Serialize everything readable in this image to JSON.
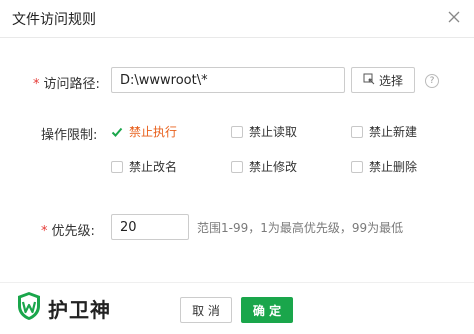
{
  "dialog": {
    "title": "文件访问规则"
  },
  "form": {
    "path_required_mark": "*",
    "path_label": "访问路径:",
    "path_value": "D:\\wwwroot\\*",
    "choose_button_label": "选择",
    "help_glyph": "?",
    "restriction_label": "操作限制:",
    "restrictions": [
      {
        "label": "禁止执行",
        "checked": true
      },
      {
        "label": "禁止读取",
        "checked": false
      },
      {
        "label": "禁止新建",
        "checked": false
      },
      {
        "label": "禁止改名",
        "checked": false
      },
      {
        "label": "禁止修改",
        "checked": false
      },
      {
        "label": "禁止删除",
        "checked": false
      }
    ],
    "priority_required_mark": "*",
    "priority_label": "优先级:",
    "priority_value": "20",
    "priority_hint": "范围1-99，1为最高优先级，99为最低"
  },
  "footer": {
    "brand": "护卫神",
    "cancel_label": "取 消",
    "ok_label": "确 定"
  },
  "colors": {
    "accent_green": "#1aa64b",
    "checked_orange": "#e8601c",
    "required_red": "#e53935"
  }
}
